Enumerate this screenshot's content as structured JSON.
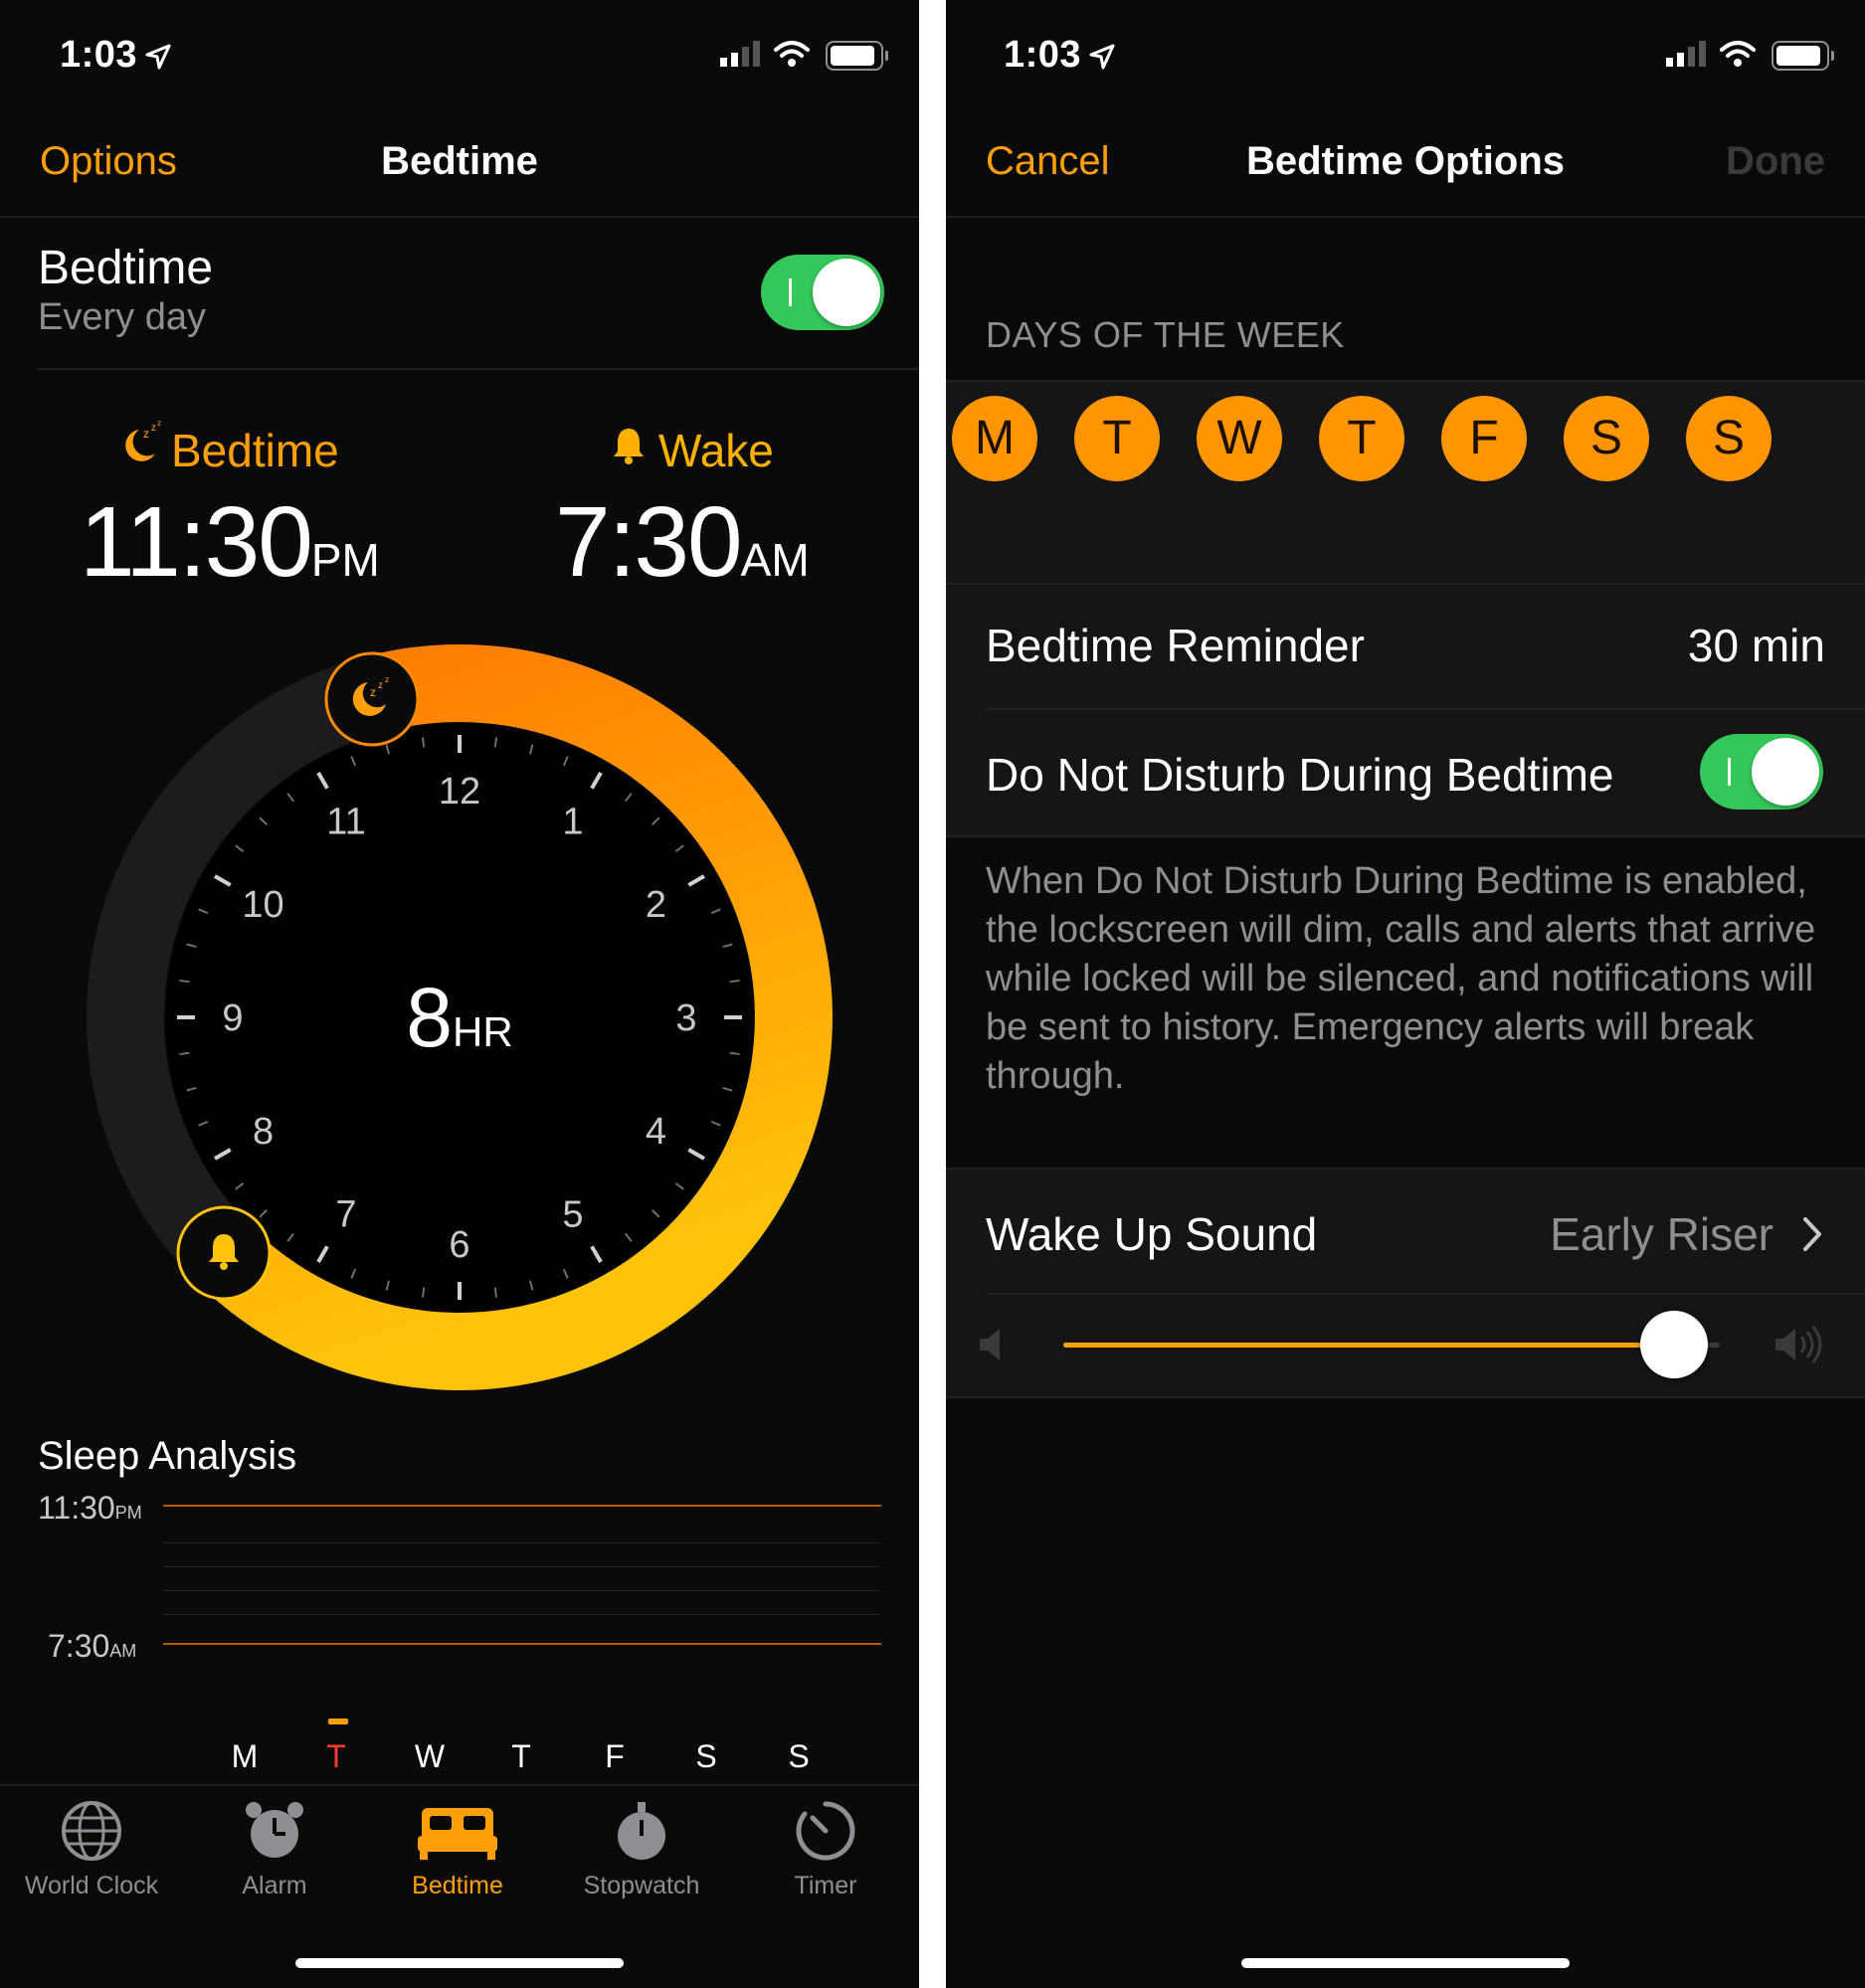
{
  "left": {
    "status": {
      "time": "1:03"
    },
    "nav": {
      "options": "Options",
      "title": "Bedtime"
    },
    "bedtime_row": {
      "title": "Bedtime",
      "subtitle": "Every day",
      "toggle_on": true
    },
    "schedule": {
      "bedtime_label": "Bedtime",
      "bedtime_time": "11:30",
      "bedtime_ampm": "PM",
      "wake_label": "Wake",
      "wake_time": "7:30",
      "wake_ampm": "AM"
    },
    "clock": {
      "duration_value": "8",
      "duration_unit": "HR",
      "hours": [
        "12",
        "1",
        "2",
        "3",
        "4",
        "5",
        "6",
        "7",
        "8",
        "9",
        "10",
        "11"
      ]
    },
    "sleep_analysis": {
      "title": "Sleep Analysis",
      "top_time": "11:30",
      "top_ampm": "PM",
      "bottom_time": "7:30",
      "bottom_ampm": "AM",
      "days": [
        "M",
        "T",
        "W",
        "T",
        "F",
        "S",
        "S"
      ],
      "current_day_index": 1
    },
    "tabs": [
      "World Clock",
      "Alarm",
      "Bedtime",
      "Stopwatch",
      "Timer"
    ],
    "active_tab": "Bedtime"
  },
  "right": {
    "status": {
      "time": "1:03"
    },
    "nav": {
      "cancel": "Cancel",
      "title": "Bedtime Options",
      "done": "Done"
    },
    "days_header": "DAYS OF THE WEEK",
    "days": [
      "M",
      "T",
      "W",
      "T",
      "F",
      "S",
      "S"
    ],
    "reminder": {
      "label": "Bedtime Reminder",
      "value": "30 min"
    },
    "dnd": {
      "label": "Do Not Disturb During Bedtime",
      "toggle_on": true,
      "description": "When Do Not Disturb During Bedtime is enabled, the lockscreen will dim, calls and alerts that arrive while locked will be silenced, and notifications will be sent to history. Emergency alerts will break through."
    },
    "wake_sound": {
      "label": "Wake Up Sound",
      "value": "Early Riser"
    },
    "volume": {
      "level": 0.93
    }
  },
  "colors": {
    "accent": "#ff9f0a",
    "toggle_green": "#34c759",
    "ring_start": "#ff7a00",
    "ring_end": "#ffc30a"
  }
}
